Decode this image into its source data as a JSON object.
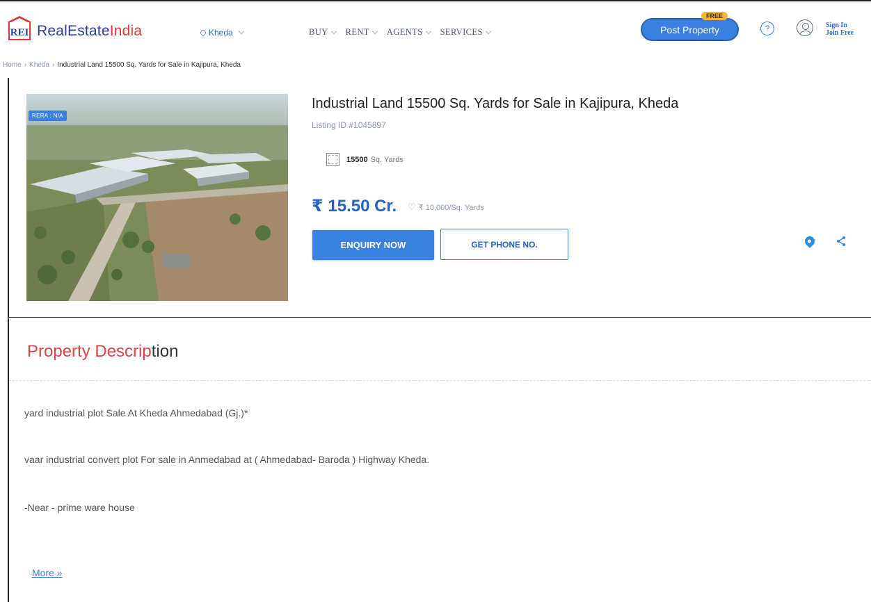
{
  "header": {
    "logo_mark": "REI",
    "logo_text_part1": "RealEstate",
    "logo_text_part2": "India",
    "location": "Kheda",
    "nav": [
      "BUY",
      "RENT",
      "AGENTS",
      "SERVICES"
    ],
    "post_property_label": "Post Property",
    "free_badge": "FREE",
    "help_glyph": "?",
    "sign_in": "Sign In",
    "join_free": "Join Free"
  },
  "breadcrumb": [
    "Home",
    "Kheda",
    "Industrial Land 15500 Sq. Yards for Sale in Kajipura, Kheda"
  ],
  "listing": {
    "rera_badge": "RERA : N/A",
    "title": "Industrial Land 15500 Sq. Yards for Sale in Kajipura, Kheda",
    "listing_id": "Listing ID #1045897",
    "area_value": "15500",
    "area_unit": "Sq. Yards",
    "price": "₹ 15.50 Cr.",
    "rate": "₹ 10,000/Sq. Yards",
    "enquiry_label": "ENQUIRY NOW",
    "phone_label": "GET PHONE NO."
  },
  "description": {
    "title_highlight": "Property Descrip",
    "title_rest": "tion",
    "lines": [
      "yard industrial plot Sale At Kheda Ahmedabad (Gj.)*",
      "vaar industrial convert plot For sale in Anmedabad at ( Ahmedabad- Baroda ) Highway Kheda.",
      "-Near - prime ware house"
    ],
    "more_label": "More »"
  },
  "colors": {
    "brand_blue": "#2a3c9c",
    "brand_red": "#d9363e",
    "accent_blue": "#3b82e0",
    "price_blue": "#2463c3",
    "free_yellow": "#f2b632"
  },
  "icons": [
    "rei-logo-icon",
    "location-pin-icon",
    "chevron-down-icon",
    "help-icon",
    "user-icon",
    "area-icon",
    "heart-icon",
    "map-pin-icon",
    "share-icon"
  ]
}
